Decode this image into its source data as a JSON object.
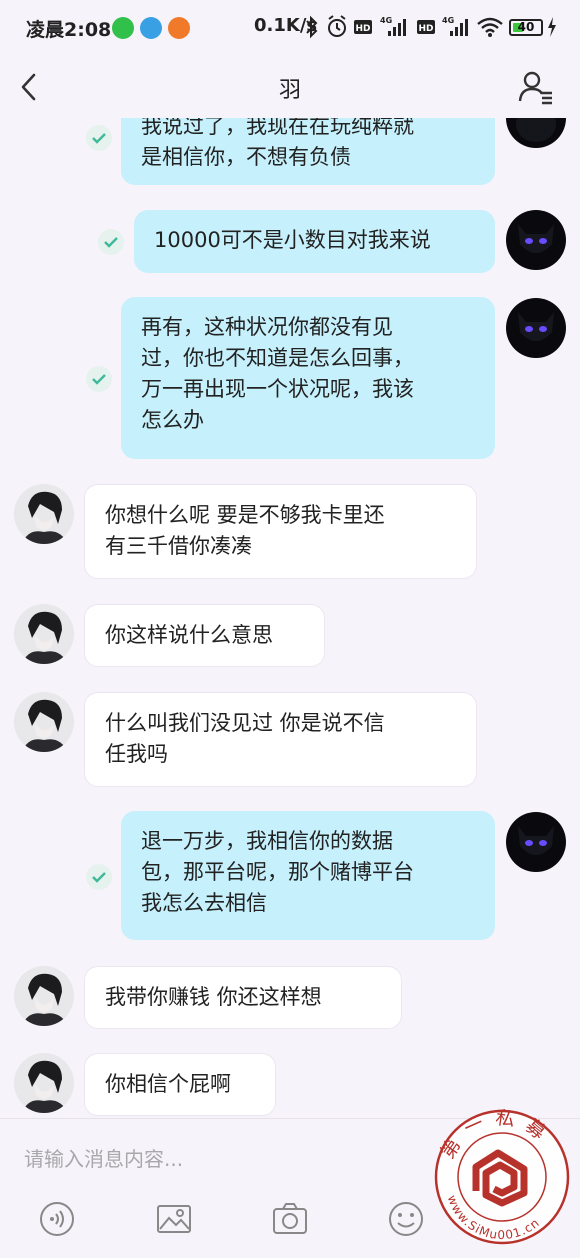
{
  "status_bar": {
    "time": "凌晨2:08",
    "network_speed": "0.1K/s",
    "battery_level": "40",
    "battery_fraction": 0.4,
    "icons": [
      "wechat-icon",
      "browser-icon",
      "app-icon",
      "bluetooth-icon",
      "alarm-icon",
      "hd-icon",
      "signal-4g-icon",
      "hd-icon",
      "signal-4g-icon",
      "wifi-icon",
      "battery-icon",
      "charging-icon"
    ]
  },
  "header": {
    "title": "羽"
  },
  "messages": [
    {
      "side": "right",
      "text": "我说过了，我现在在玩纯粹就是相信你，不想有负债"
    },
    {
      "side": "right",
      "text": "10000可不是小数目对我来说"
    },
    {
      "side": "right",
      "text": "再有，这种状况你都没有见过，你也不知道是怎么回事，万一再出现一个状况呢，我该怎么办"
    },
    {
      "side": "left",
      "text": "你想什么呢  要是不够我卡里还有三千借你凑凑"
    },
    {
      "side": "left",
      "text": "你这样说什么意思"
    },
    {
      "side": "left",
      "text": "什么叫我们没见过  你是说不信任我吗"
    },
    {
      "side": "right",
      "text": "退一万步，我相信你的数据包，那平台呢，那个赌博平台我怎么去相信"
    },
    {
      "side": "left",
      "text": "我带你赚钱  你还这样想"
    },
    {
      "side": "left",
      "text": "你相信个屁啊"
    }
  ],
  "message_lines": {
    "m0": [
      "我说过了，我现在在玩纯粹就",
      "是相信你，不想有负债"
    ],
    "m1": [
      "10000可不是小数目对我来说"
    ],
    "m2": [
      "再有，这种状况你都没有见",
      "过，你也不知道是怎么回事，",
      "万一再出现一个状况呢，我该",
      "怎么办"
    ],
    "m3": [
      "你想什么呢   要是不够我卡里还",
      "有三千借你凑凑"
    ],
    "m4": [
      "你这样说什么意思"
    ],
    "m5": [
      "什么叫我们没见过  你是说不信",
      "任我吗"
    ],
    "m6": [
      "退一万步，我相信你的数据",
      "包，那平台呢，那个赌博平台",
      "我怎么去相信"
    ],
    "m7": [
      "我带你赚钱  你还这样想"
    ],
    "m8": [
      "你相信个屁啊"
    ]
  },
  "input": {
    "placeholder": "请输入消息内容..."
  },
  "toolbar": {
    "items": [
      "voice-icon",
      "image-icon",
      "camera-icon",
      "emoji-icon"
    ]
  },
  "watermark": {
    "top_text": "第一私募",
    "bottom_text": "www.SiMu001.cn"
  },
  "colors": {
    "background": "#f7f3fa",
    "my_bubble": "#c6f0fb",
    "their_bubble": "#ffffff",
    "check": "#3fb99a",
    "seal_red": "#b8322c"
  }
}
